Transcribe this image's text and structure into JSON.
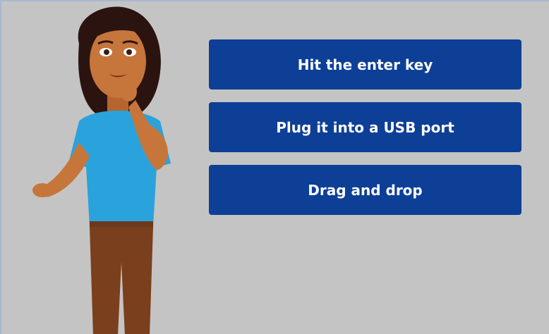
{
  "quiz": {
    "options": [
      {
        "label": "Hit the enter key"
      },
      {
        "label": "Plug it into a USB port"
      },
      {
        "label": "Drag and drop"
      }
    ]
  },
  "colors": {
    "background": "#c4c4c4",
    "button": "#0d3f96",
    "button_text": "#ffffff"
  },
  "character": {
    "description_icon": "presenter-illustration"
  }
}
